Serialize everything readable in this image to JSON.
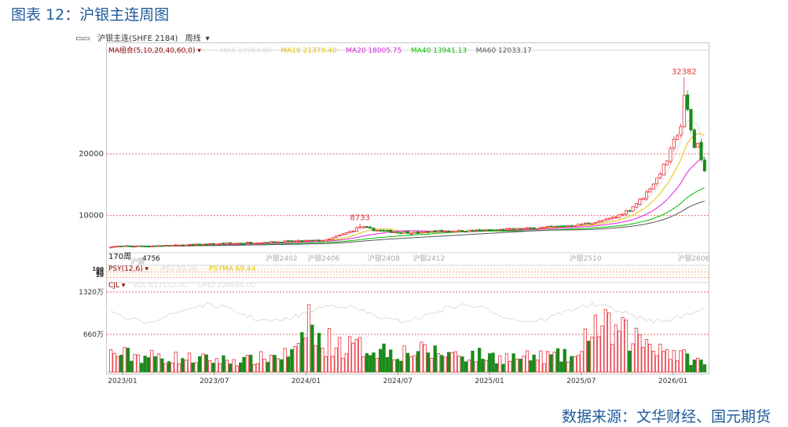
{
  "figure": {
    "title": "图表 12：沪银主连周图",
    "source": "数据来源：文华财经、国元期货"
  },
  "toolbar": {
    "instrument": "沪银主连(SHFE 2184)",
    "period": "周线",
    "chevron": "▾",
    "icon": "tag-icon"
  },
  "ma_legend": {
    "group_label": "MA组合(5,10,20,40,60,0)",
    "items": [
      {
        "label": "MA5 19964.80",
        "color": "#dcdcdc"
      },
      {
        "label": "MA10 21379.40",
        "color": "#e6c000"
      },
      {
        "label": "MA20 18005.75",
        "color": "#e020e0"
      },
      {
        "label": "MA40 13941.13",
        "color": "#00c000"
      },
      {
        "label": "MA60 12033.17",
        "color": "#555555"
      }
    ]
  },
  "psy_legend": {
    "group_label": "PSY(12,6)",
    "items": [
      {
        "label": "PSY 50.00",
        "color": "#dcdcdc"
      },
      {
        "label": "PSYMA 69.44",
        "color": "#e6c000"
      }
    ]
  },
  "cjl_legend": {
    "group_label": "CJL",
    "items": [
      {
        "label": "VOL 617152.00",
        "color": "#dcdcdc"
      },
      {
        "label": "OPID 228694.00",
        "color": "#dcdcdc"
      }
    ]
  },
  "contract_labels": [
    {
      "label": "沪银2402",
      "pos": 0.29
    },
    {
      "label": "沪银2406",
      "pos": 0.36
    },
    {
      "label": "沪银2408",
      "pos": 0.46
    },
    {
      "label": "沪银2412",
      "pos": 0.535
    },
    {
      "label": "沪银2510",
      "pos": 0.795
    },
    {
      "label": "沪银2606",
      "pos": 0.975
    }
  ],
  "overlay_labels": {
    "left_a": "170周",
    "left_b": "4756",
    "contract_a": "沪银"
  },
  "psy_axis_labels": [
    "100",
    "80",
    "48",
    "40",
    "20"
  ],
  "colors": {
    "up": "#e8303a",
    "down": "#1a8a1a",
    "grid": "#e0b0b0",
    "axis_text": "#333333",
    "title": "#1f5b9c"
  },
  "chart_data": {
    "type": "candlestick",
    "title": "沪银主连周图",
    "x_tick_labels": [
      "2023/01",
      "2023/07",
      "2024/01",
      "2024/07",
      "2025/01",
      "2025/07",
      "2026/01"
    ],
    "price_axis": {
      "ticks": [
        10000,
        20000
      ],
      "ylim": [
        4000,
        36500
      ]
    },
    "volume_axis": {
      "ticks": [
        "1320万",
        "660万"
      ],
      "max_wan": 1320
    },
    "annotations": [
      {
        "label": "32382",
        "value": 32382,
        "type": "max"
      },
      {
        "label": "8733",
        "value": 8733,
        "type": "local-max"
      }
    ],
    "weeks": 175,
    "price_close_keyframes": [
      [
        0,
        5000
      ],
      [
        20,
        5200
      ],
      [
        40,
        5600
      ],
      [
        50,
        5800
      ],
      [
        55,
        5900
      ],
      [
        63,
        6000
      ],
      [
        70,
        7400
      ],
      [
        73,
        8200
      ],
      [
        77,
        7700
      ],
      [
        82,
        7400
      ],
      [
        90,
        7200
      ],
      [
        95,
        7500
      ],
      [
        110,
        7600
      ],
      [
        125,
        8000
      ],
      [
        135,
        8400
      ],
      [
        143,
        9000
      ],
      [
        148,
        9800
      ],
      [
        152,
        11000
      ],
      [
        156,
        13000
      ],
      [
        160,
        16000
      ],
      [
        163,
        19000
      ],
      [
        165,
        22000
      ],
      [
        167,
        24500
      ],
      [
        168,
        29000
      ],
      [
        169,
        27000
      ],
      [
        170,
        24000
      ],
      [
        171,
        21000
      ],
      [
        172,
        22000
      ],
      [
        173,
        19000
      ],
      [
        174,
        17000
      ]
    ],
    "volume_keyframes_wan": [
      [
        0,
        300
      ],
      [
        10,
        260
      ],
      [
        20,
        230
      ],
      [
        30,
        200
      ],
      [
        40,
        190
      ],
      [
        50,
        280
      ],
      [
        55,
        320
      ],
      [
        58,
        980
      ],
      [
        60,
        480
      ],
      [
        65,
        500
      ],
      [
        68,
        420
      ],
      [
        75,
        400
      ],
      [
        85,
        330
      ],
      [
        90,
        340
      ],
      [
        100,
        300
      ],
      [
        110,
        260
      ],
      [
        120,
        230
      ],
      [
        130,
        260
      ],
      [
        138,
        240
      ],
      [
        140,
        820
      ],
      [
        145,
        700
      ],
      [
        150,
        620
      ],
      [
        155,
        540
      ],
      [
        160,
        460
      ],
      [
        165,
        300
      ],
      [
        170,
        220
      ],
      [
        174,
        140
      ]
    ]
  }
}
